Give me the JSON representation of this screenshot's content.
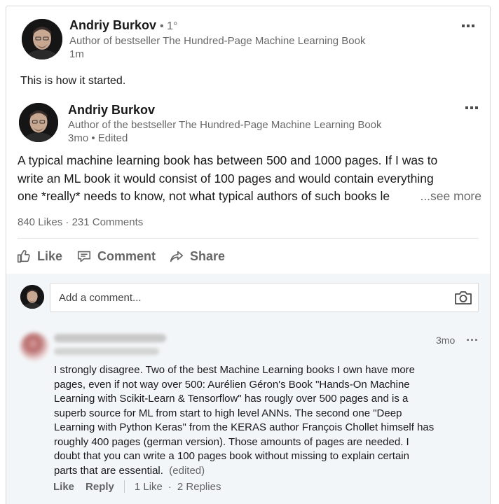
{
  "share": {
    "author_name": "Andriy Burkov",
    "degree": "• 1°",
    "headline": "Author of bestseller The Hundred-Page Machine Learning Book",
    "time": "1m",
    "text": "This is how it started."
  },
  "post": {
    "author_name": "Andriy Burkov",
    "headline": "Author of the bestseller The Hundred-Page Machine Learning Book",
    "time": "3mo • Edited",
    "body_lines": [
      "A typical machine learning book has between 500 and 1000 pages. If I was to",
      "write an ML book it would consist of 100 pages and would contain everything",
      "one *really* needs to know, not what typical authors of such books le"
    ],
    "see_more": "...see more",
    "likes": "840 Likes",
    "separator": "·",
    "comments": "231 Comments"
  },
  "actions": {
    "like": "Like",
    "comment": "Comment",
    "share": "Share"
  },
  "comment_input": {
    "placeholder": "Add a comment..."
  },
  "comment": {
    "time": "3mo",
    "text_lines": [
      "I strongly disagree. Two of the best Machine Learning books I own have more",
      "pages, even if not way over 500: Aurélien Géron's Book \"Hands-On Machine",
      "Learning with Scikit-Learn & Tensorflow\" has rougly over 500 pages and is a",
      "superb source for ML from start to high level ANNs. The second one \"Deep",
      "Learning with Python Keras\" from the KERAS author François Chollet himself has",
      "roughly 400 pages (german version). Those amounts of pages are needed. I",
      "doubt that you can write a 100 pages book without missing to explain certain",
      "parts that are essential."
    ],
    "edited": "(edited)",
    "like_label": "Like",
    "reply_label": "Reply",
    "like_count": "1 Like",
    "separator": "·",
    "replies": "2 Replies"
  },
  "icons": {
    "like": "thumbs-up-icon",
    "comment": "comment-icon",
    "share": "share-arrow-icon",
    "camera": "camera-icon",
    "more": "more-dots-icon"
  }
}
